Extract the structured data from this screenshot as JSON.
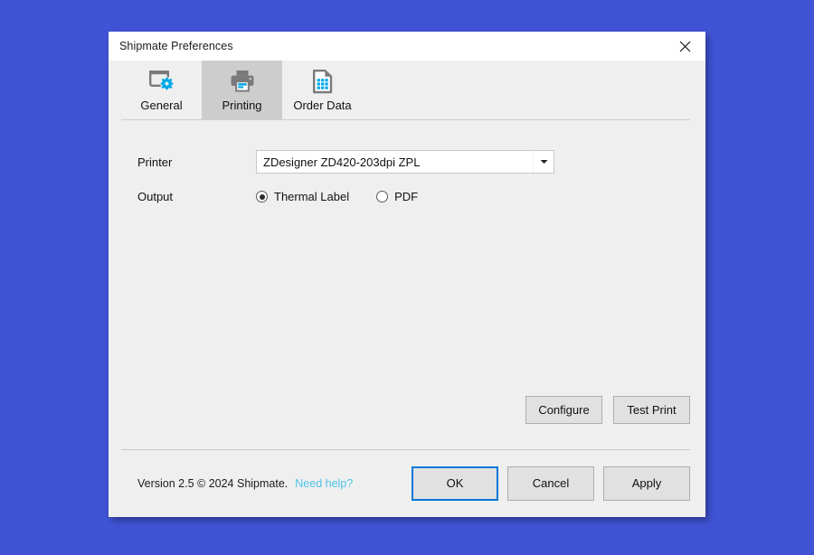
{
  "window": {
    "title": "Shipmate Preferences",
    "close_icon": "close-icon"
  },
  "tabs": [
    {
      "label": "General",
      "icon": "window-gear-icon",
      "active": false
    },
    {
      "label": "Printing",
      "icon": "printer-icon",
      "active": true
    },
    {
      "label": "Order Data",
      "icon": "document-grid-icon",
      "active": false
    }
  ],
  "fields": {
    "printer": {
      "label": "Printer",
      "value": "ZDesigner ZD420-203dpi ZPL",
      "arrow_icon": "chevron-down-icon"
    },
    "output": {
      "label": "Output",
      "options": [
        {
          "label": "Thermal Label",
          "selected": true
        },
        {
          "label": "PDF",
          "selected": false
        }
      ]
    }
  },
  "content_actions": [
    {
      "label": "Configure"
    },
    {
      "label": "Test Print"
    }
  ],
  "footer": {
    "version_text": "Version 2.5 © 2024 Shipmate.",
    "help_link": "Need help?",
    "buttons": [
      {
        "label": "OK",
        "primary": true
      },
      {
        "label": "Cancel",
        "primary": false
      },
      {
        "label": "Apply",
        "primary": false
      }
    ]
  },
  "colors": {
    "desktop_background": "#4053d4",
    "dialog_background": "#efefef",
    "titlebar_background": "#ffffff",
    "active_tab_background": "#cdcdcd",
    "accent": "#0078d7",
    "icon_gray": "#7a7a7a",
    "icon_blue": "#00a8e8",
    "link": "#4fc3e8",
    "button_face": "#e1e1e1"
  }
}
